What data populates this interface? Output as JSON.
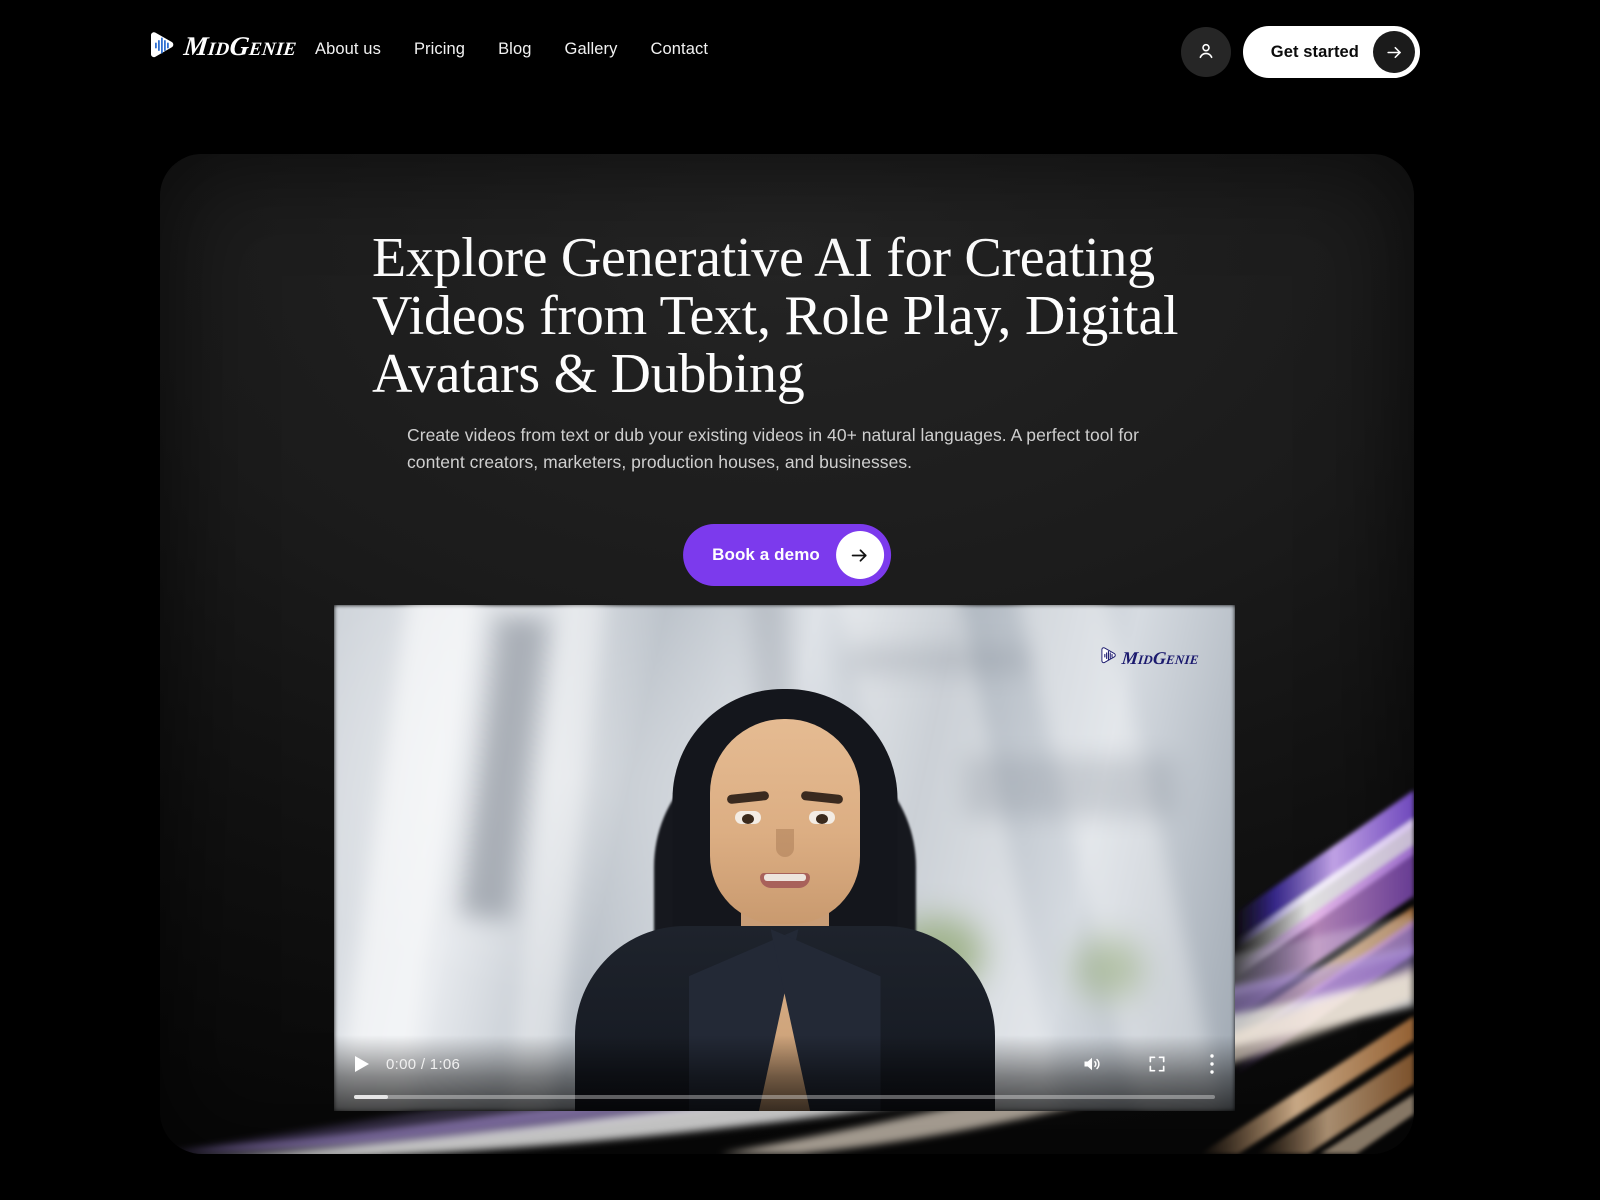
{
  "brand": {
    "name": "MidGenie",
    "logo_icon": "play-waveform-icon",
    "color": "#ffffff"
  },
  "nav": {
    "items": [
      {
        "label": "About us"
      },
      {
        "label": "Pricing"
      },
      {
        "label": "Blog"
      },
      {
        "label": "Gallery"
      },
      {
        "label": "Contact"
      }
    ]
  },
  "header_actions": {
    "account_icon": "user-icon",
    "cta_label": "Get started",
    "cta_icon": "arrow-right-icon"
  },
  "hero": {
    "title": "Explore Generative AI for Creating Videos from Text, Role Play, Digital Avatars & Dubbing",
    "subtitle": "Create videos from text or dub your existing videos in 40+ natural languages. A perfect tool for content creators, marketers, production houses, and businesses.",
    "cta_label": "Book a demo",
    "cta_icon": "arrow-right-icon",
    "cta_color": "#7c3aed"
  },
  "video": {
    "watermark": "MidGenie",
    "watermark_color": "#1b1a6e",
    "current_time": "0:00",
    "duration": "1:06",
    "time_display": "0:00 / 1:06",
    "progress_percent": 4,
    "controls": {
      "play_label": "play",
      "mute_label": "mute",
      "fullscreen_label": "full screen",
      "more_label": "more options"
    }
  },
  "theme": {
    "background": "#000000",
    "card_background": "#1b1b1b",
    "accent": "#7c3aed",
    "text_primary": "#ffffff",
    "text_secondary": "#cfcfcf"
  }
}
